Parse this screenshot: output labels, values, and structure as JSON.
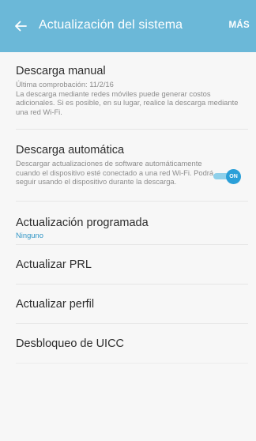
{
  "appbar": {
    "title": "Actualización del sistema",
    "more_label": "MÁS",
    "back_icon": "arrow-left-icon",
    "background_color": "#6bb8d8"
  },
  "items": [
    {
      "title": "Descarga manual",
      "subtitle": "Última comprobación: 11/2/16\nLa descarga mediante redes móviles puede generar costos adicionales. Si es posible, en su lugar, realice la descarga mediante una red Wi-Fi."
    },
    {
      "title": "Descarga automática",
      "subtitle": "Descargar actualizaciones de software automáticamente cuando el dispositivo esté conectado a una red Wi-Fi. Podrá seguir usando el dispositivo durante la descarga.",
      "toggle": {
        "state": "on",
        "label": "ON"
      }
    },
    {
      "title": "Actualización programada",
      "subtitle": "Ninguno"
    },
    {
      "title": "Actualizar PRL"
    },
    {
      "title": "Actualizar perfil"
    },
    {
      "title": "Desbloqueo de UICC"
    }
  ],
  "colors": {
    "accent": "#2a9fd8",
    "toggle_track": "#8fd0ea",
    "subtitle_blue": "#3296c6"
  }
}
